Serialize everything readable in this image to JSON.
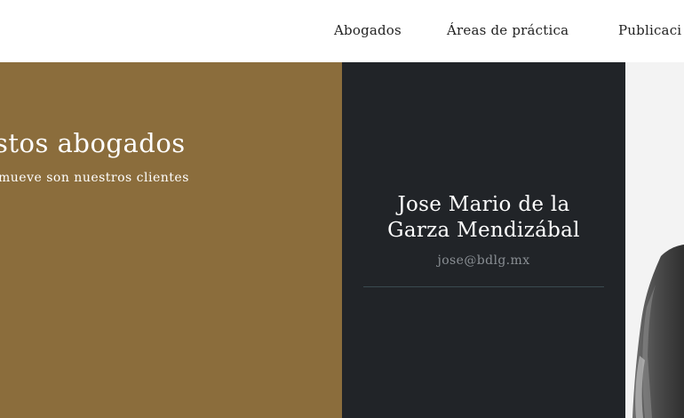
{
  "nav": {
    "items": [
      {
        "label": "Abogados"
      },
      {
        "label": "Áreas de práctica"
      },
      {
        "label": "Publicaci"
      }
    ]
  },
  "hero": {
    "title": "stos abogados",
    "subtitle": "mueve son nuestros clientes"
  },
  "lawyer": {
    "name_line1": "Jose Mario de la",
    "name_line2": "Garza Mendizábal",
    "email": "jose@bdlg.mx"
  },
  "colors": {
    "gold_panel": "#8b6d3c",
    "dark_panel": "#212428",
    "photo_bg": "#f3f3f3"
  }
}
